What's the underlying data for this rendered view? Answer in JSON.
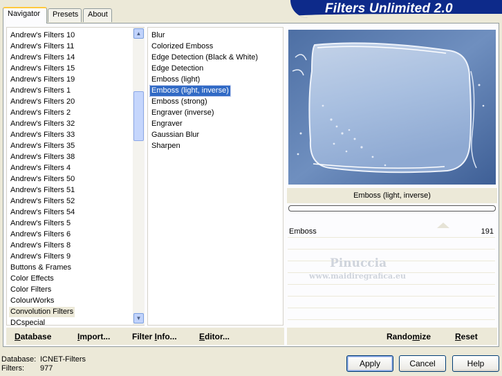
{
  "tabs": [
    "Navigator",
    "Presets",
    "About"
  ],
  "app_title": "Filters Unlimited 2.0",
  "categories": [
    "Andrew's Filters 10",
    "Andrew's Filters 11",
    "Andrew's Filters 14",
    "Andrew's Filters 15",
    "Andrew's Filters 19",
    "Andrew's Filters 1",
    "Andrew's Filters 20",
    "Andrew's Filters 2",
    "Andrew's Filters 32",
    "Andrew's Filters 33",
    "Andrew's Filters 35",
    "Andrew's Filters 38",
    "Andrew's Filters 4",
    "Andrew's Filters 50",
    "Andrew's Filters 51",
    "Andrew's Filters 52",
    "Andrew's Filters 54",
    "Andrew's Filters 5",
    "Andrew's Filters 6",
    "Andrew's Filters 8",
    "Andrew's Filters 9",
    "Buttons & Frames",
    "Color Effects",
    "Color Filters",
    "ColourWorks",
    "Convolution Filters",
    "DCspecial"
  ],
  "filters": [
    "Blur",
    "Colorized Emboss",
    "Edge Detection (Black & White)",
    "Edge Detection",
    "Emboss (light)",
    "Emboss (light, inverse)",
    "Emboss (strong)",
    "Engraver (inverse)",
    "Engraver",
    "Gaussian Blur",
    "Sharpen"
  ],
  "current_filter": "Emboss (light, inverse)",
  "param": {
    "name": "Emboss",
    "value": "191",
    "fraction": 0.75
  },
  "watermark": {
    "name": "Pinuccia",
    "url": "www.maidiregrafica.eu"
  },
  "bottom_left": {
    "database": {
      "u": "D",
      "rest": "atabase"
    },
    "import": {
      "u": "I",
      "rest": "mport..."
    },
    "filter_info": {
      "pre": "Filter ",
      "u": "I",
      "rest": "nfo..."
    },
    "editor": {
      "u": "E",
      "rest": "ditor..."
    }
  },
  "bottom_right": {
    "randomize": {
      "pre": "Rando",
      "u": "m",
      "rest": "ize"
    },
    "reset": {
      "u": "R",
      "rest": "eset"
    }
  },
  "status": {
    "database_label": "Database:",
    "database_value": "ICNET-Filters",
    "filters_label": "Filters:",
    "filters_value": "977"
  },
  "buttons": {
    "apply": "Apply",
    "cancel": "Cancel",
    "help": "Help"
  },
  "colors": {
    "selection": "#316ac5",
    "banner": "#0d2a8a",
    "tab_highlight": "#ffc83c"
  }
}
